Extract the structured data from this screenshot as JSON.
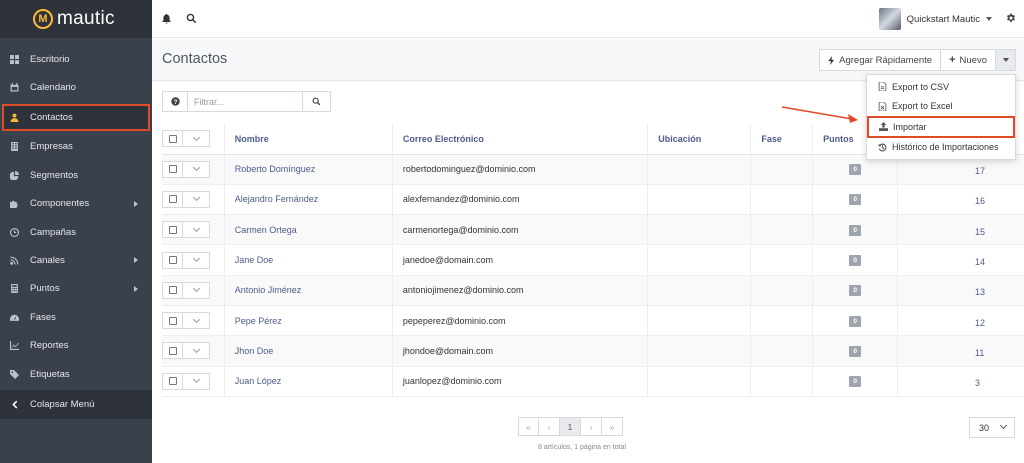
{
  "brand": {
    "name": "mautic",
    "accent": "#fdb933"
  },
  "sidebar": {
    "items": [
      {
        "label": "Escritorio",
        "icon": "dashboard-icon"
      },
      {
        "label": "Calendario",
        "icon": "calendar-icon"
      },
      {
        "label": "Contactos",
        "icon": "user-icon",
        "active": true
      },
      {
        "label": "Empresas",
        "icon": "building-icon"
      },
      {
        "label": "Segmentos",
        "icon": "pie-chart-icon"
      },
      {
        "label": "Componentes",
        "icon": "puzzle-icon",
        "submenu": true
      },
      {
        "label": "Campañas",
        "icon": "clock-icon"
      },
      {
        "label": "Canales",
        "icon": "rss-icon",
        "submenu": true
      },
      {
        "label": "Puntos",
        "icon": "calculator-icon",
        "submenu": true
      },
      {
        "label": "Fases",
        "icon": "tachometer-icon"
      },
      {
        "label": "Reportes",
        "icon": "line-chart-icon"
      },
      {
        "label": "Etiquetas",
        "icon": "tag-icon"
      }
    ],
    "collapse_label": "Colapsar Menú"
  },
  "topbar": {
    "user_name": "Quickstart Mautic"
  },
  "page": {
    "title": "Contactos",
    "quick_add_label": "Agregar Rápidamente",
    "new_label": "Nuevo"
  },
  "dropdown": {
    "items": [
      {
        "label": "Export to CSV",
        "icon": "file-csv-icon"
      },
      {
        "label": "Export to Excel",
        "icon": "file-excel-icon"
      },
      {
        "label": "Importar",
        "icon": "upload-icon",
        "highlighted": true
      },
      {
        "label": "Histórico de Importaciones",
        "icon": "history-icon"
      }
    ]
  },
  "filter": {
    "placeholder": "Filtrar..."
  },
  "table": {
    "columns": [
      "Nombre",
      "Correo Electrónico",
      "Ubicación",
      "Fase",
      "Puntos"
    ],
    "rows": [
      {
        "name": "Roberto Domínguez",
        "email": "robertodominguez@dominio.com",
        "points": "0",
        "id": "17"
      },
      {
        "name": "Alejandro Fernández",
        "email": "alexfernandez@dominio.com",
        "points": "0",
        "id": "16"
      },
      {
        "name": "Carmen Ortega",
        "email": "carmenortega@dominio.com",
        "points": "0",
        "id": "15"
      },
      {
        "name": "Jane Doe",
        "email": "janedoe@domain.com",
        "points": "0",
        "id": "14"
      },
      {
        "name": "Antonio Jiménez",
        "email": "antoniojimenez@dominio.com",
        "points": "0",
        "id": "13"
      },
      {
        "name": "Pepe Pérez",
        "email": "pepeperez@dominio.com",
        "points": "0",
        "id": "12"
      },
      {
        "name": "Jhon Doe",
        "email": "jhondoe@domain.com",
        "points": "0",
        "id": "11"
      },
      {
        "name": "Juan López",
        "email": "juanlopez@dominio.com",
        "points": "0",
        "id": "3"
      }
    ]
  },
  "pagination": {
    "current_page": "1",
    "info": "8 artículos, 1 página en total",
    "per_page": "30"
  },
  "annotation_color": "#e04a27"
}
